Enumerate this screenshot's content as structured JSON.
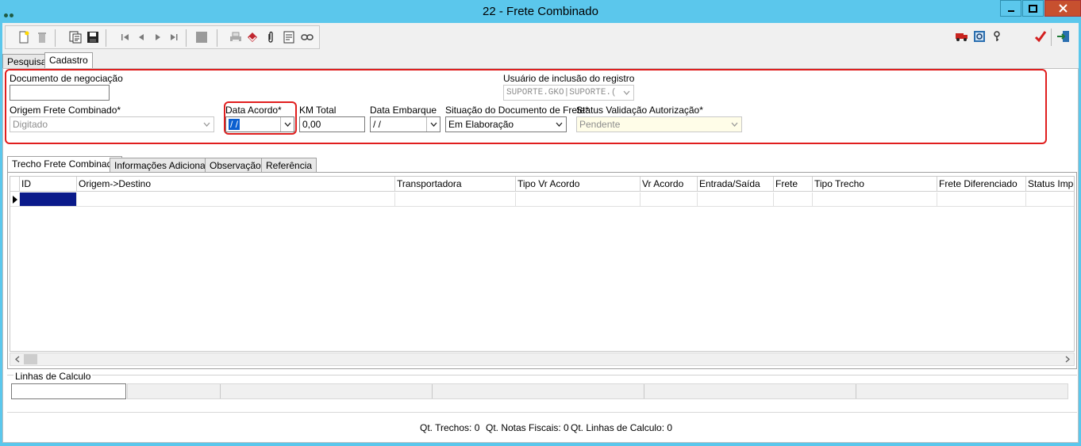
{
  "window": {
    "title": "22 - Frete Combinado",
    "minimize_label": "_",
    "maximize_label": "□",
    "close_label": "✕"
  },
  "tabs": [
    {
      "label": "Pesquisa"
    },
    {
      "label": "Cadastro"
    }
  ],
  "form": {
    "documento_label": "Documento de negociação",
    "documento_value": "",
    "usuario_label": "Usuário de inclusão do registro",
    "usuario_value": "SUPORTE.GKO|SUPORTE.(",
    "origem_label": "Origem Frete Combinado*",
    "origem_value": "Digitado",
    "data_acordo_label": "Data Acordo*",
    "data_acordo_value": " /  / ",
    "km_label": "KM Total",
    "km_value": "0,00",
    "data_embarque_label": "Data Embarque",
    "data_embarque_value": " /  / ",
    "situacao_label": "Situação do Documento de Frete*",
    "situacao_value": "Em Elaboração",
    "status_label": "Status Validação Autorização*",
    "status_value": "Pendente"
  },
  "subtabs": [
    {
      "label": "Trecho Frete Combinado"
    },
    {
      "label": "Informações Adicionais"
    },
    {
      "label": "Observação"
    },
    {
      "label": "Referência"
    }
  ],
  "grid": {
    "columns": [
      "ID",
      "Origem->Destino",
      "Transportadora",
      "Tipo Vr Acordo",
      "Vr Acordo",
      "Entrada/Saída",
      "Frete",
      "Tipo Trecho",
      "Frete Diferenciado",
      "Status Impo"
    ]
  },
  "linhas": {
    "label": "Linhas de Calculo"
  },
  "status": {
    "trechos": "Qt. Trechos: 0",
    "notas": "Qt. Notas Fiscais: 0",
    "linhas": "Qt. Linhas de Calculo: 0"
  },
  "colors": {
    "title_bg": "#5bc7ec",
    "highlight": "#e01e1e",
    "selection": "#0a5fd0",
    "grid_selected_cell": "#0a1a8a"
  },
  "icons": [
    "new-icon",
    "delete-icon",
    "copy-icon",
    "save-icon",
    "first-icon",
    "prev-icon",
    "next-icon",
    "last-icon",
    "stop-icon",
    "print-icon",
    "tag-icon",
    "attach-icon",
    "report-icon",
    "link-icon",
    "truck-icon",
    "search-report-icon",
    "key-icon",
    "confirm-icon",
    "exit-icon"
  ]
}
